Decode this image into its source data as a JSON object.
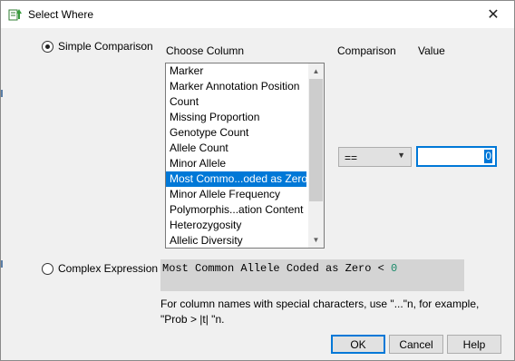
{
  "window": {
    "title": "Select Where",
    "close_label": "✕"
  },
  "simple": {
    "label": "Simple Comparison",
    "choose_column_header": "Choose Column",
    "comparison_header": "Comparison",
    "value_header": "Value",
    "columns": [
      "Marker",
      "Marker Annotation Position",
      "Count",
      "Missing Proportion",
      "Genotype Count",
      "Allele Count",
      "Minor Allele",
      "Most Commo...oded as Zero",
      "Minor Allele Frequency",
      "Polymorphis...ation Content",
      "Heterozygosity",
      "Allelic Diversity"
    ],
    "selected_index": 7,
    "comparison_value": "==",
    "value": "0"
  },
  "complex": {
    "label": "Complex Expression",
    "expression_text": "Most Common Allele Coded as Zero < ",
    "expression_number": "0",
    "hint": "For column names with special characters, use \"...\"n, for example, \"Prob > |t| \"n."
  },
  "buttons": {
    "ok": "OK",
    "cancel": "Cancel",
    "help": "Help"
  },
  "icons": {
    "app": "select-where-icon",
    "close": "close-icon",
    "scroll_up": "scroll-up-icon",
    "scroll_down": "scroll-down-icon",
    "dropdown": "chevron-down-icon"
  },
  "colors": {
    "selection": "#0078d7",
    "expression_bg": "#d4d4d4",
    "number": "#1a8a6a"
  }
}
